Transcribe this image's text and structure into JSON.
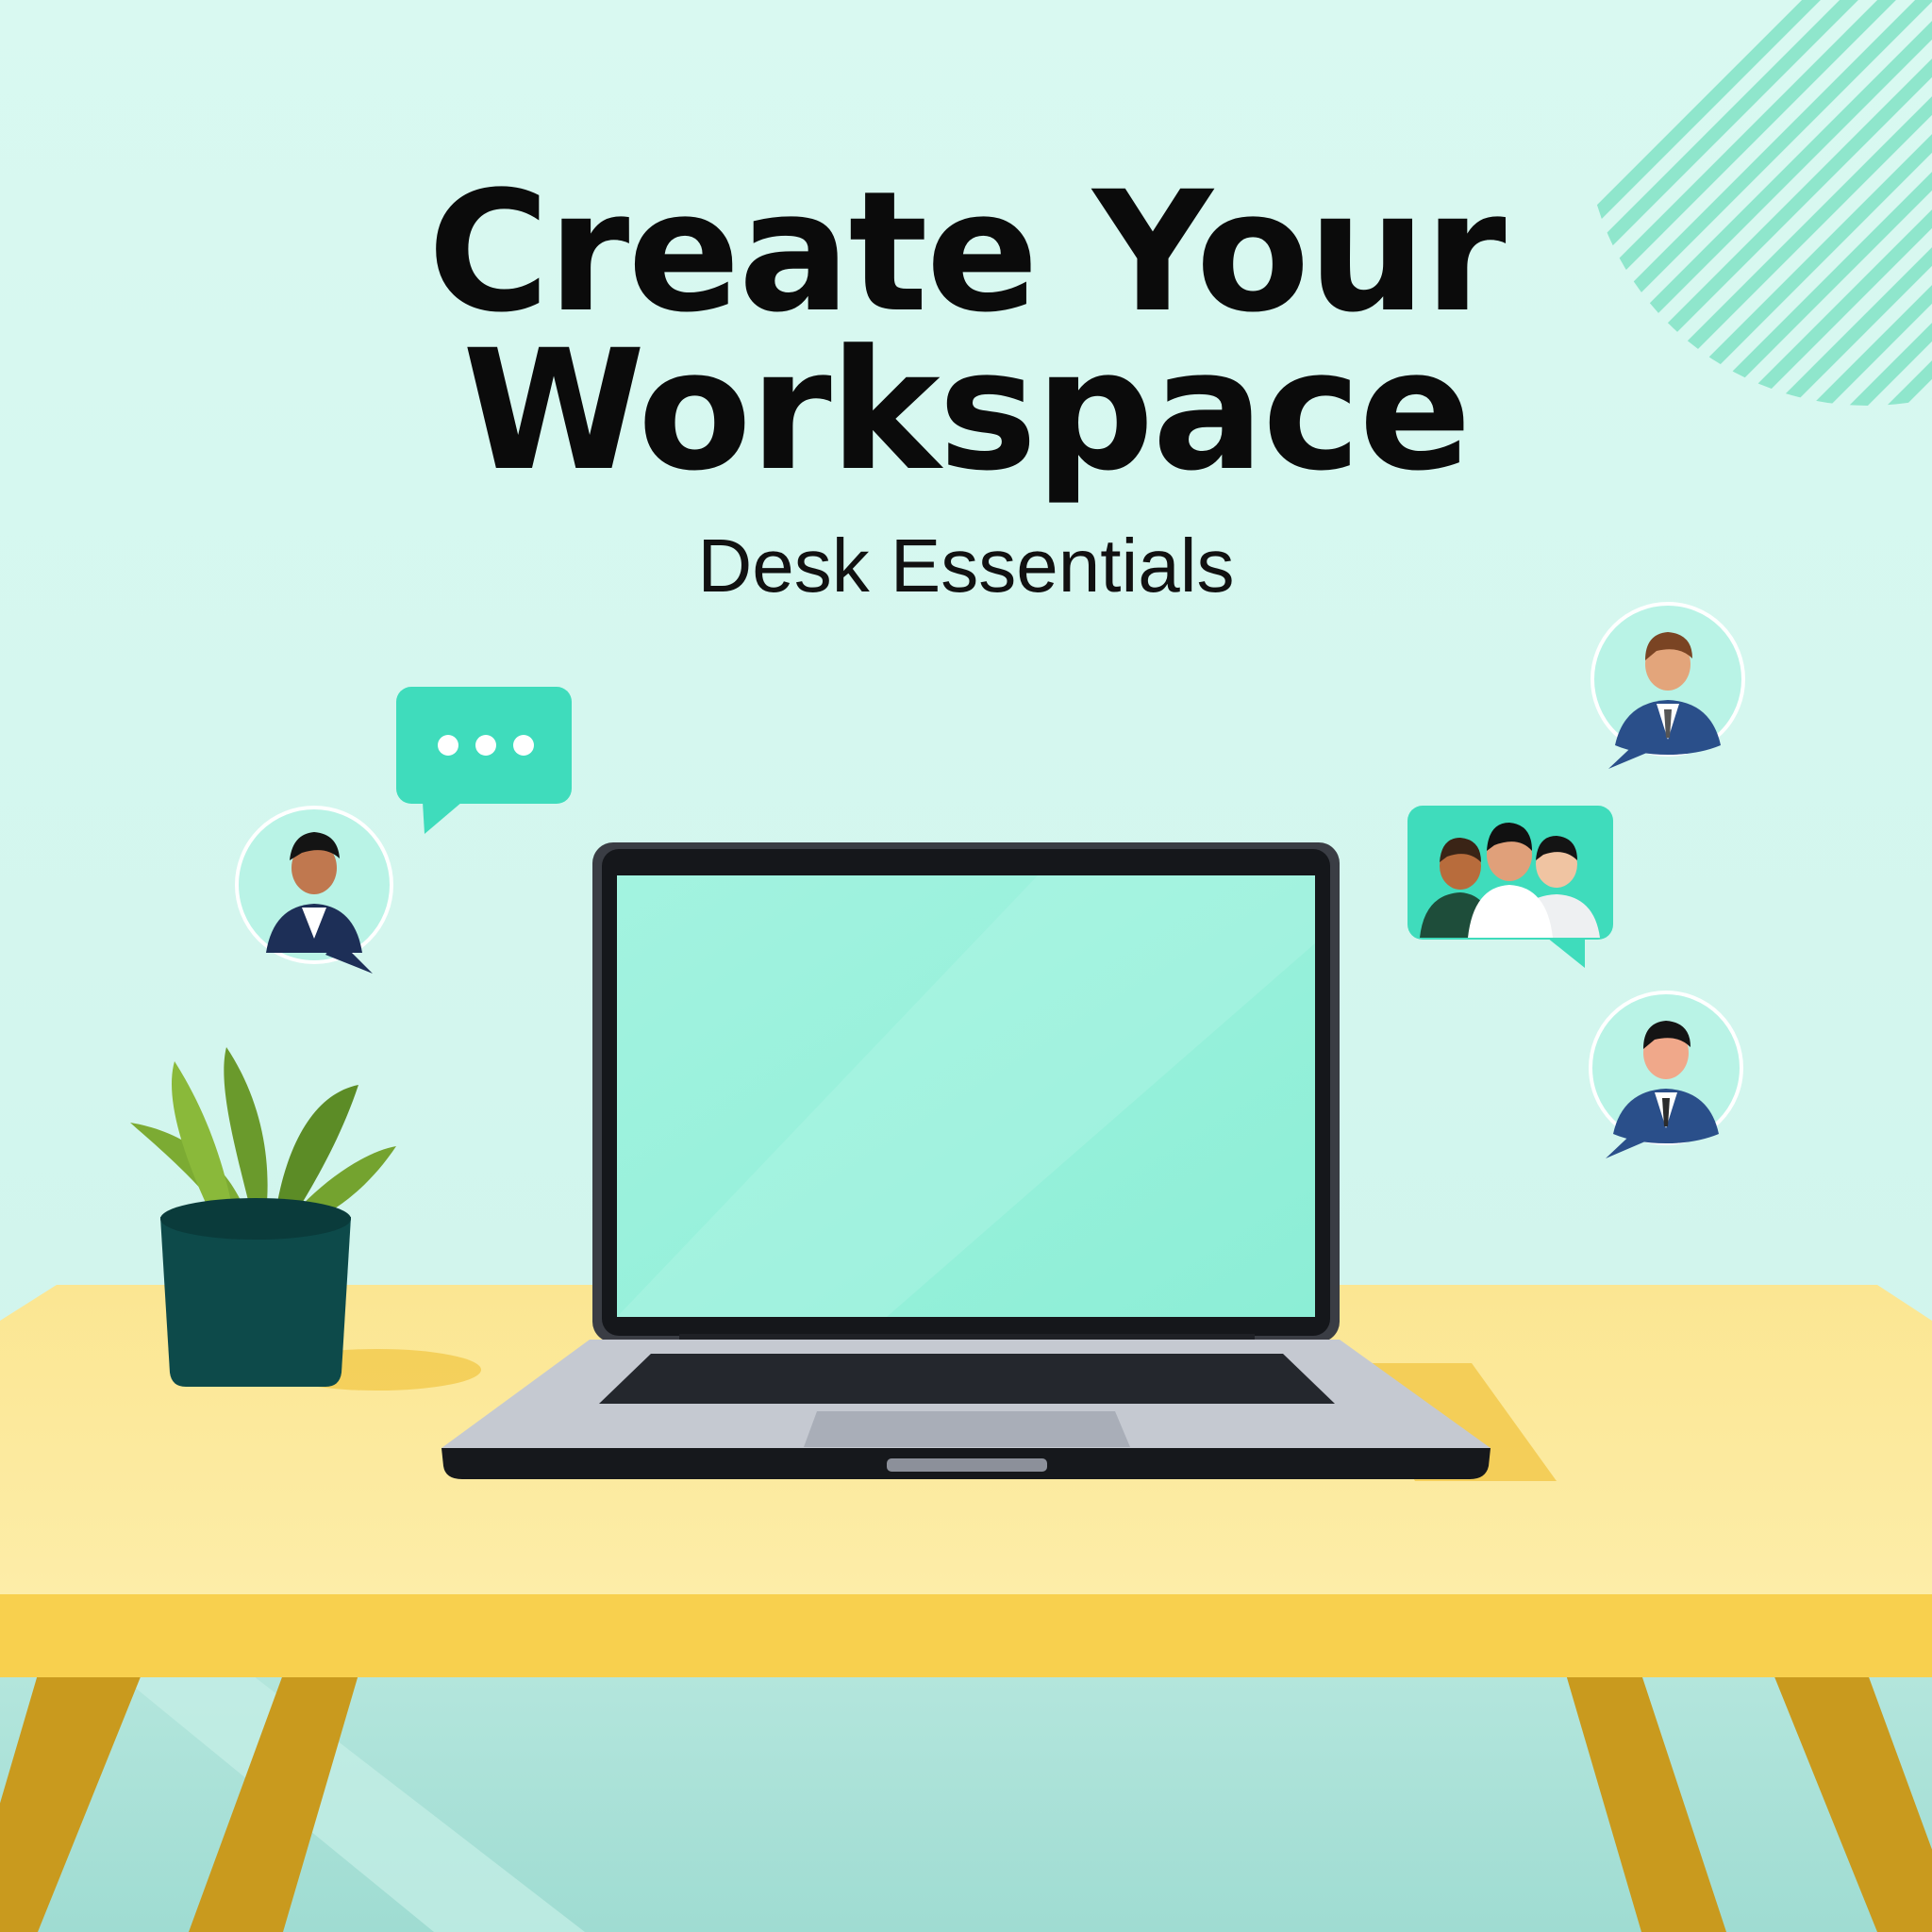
{
  "headline": {
    "line1": "Create Your",
    "line2": "Workspace"
  },
  "subtitle": "Desk Essentials",
  "icons": {
    "chat_bubble": "chat-bubble-icon",
    "avatar_left": "person-avatar-icon",
    "avatar_top_right": "person-avatar-icon",
    "team_group": "team-group-icon",
    "avatar_bottom_right": "person-avatar-icon"
  },
  "colors": {
    "background": "#d6f7ef",
    "accent_teal": "#3fdcbc",
    "desk_top": "#fbe88c",
    "desk_edge": "#f8d04e",
    "desk_legs": "#c99a1e",
    "plant_pot": "#0d4a4a",
    "plant_leaves": "#6a9a2c",
    "laptop_screen": "#9ef2dd",
    "laptop_body": "#c8ccd4",
    "suit_blue": "#2a4f8a",
    "title_text": "#0b0b0b"
  }
}
